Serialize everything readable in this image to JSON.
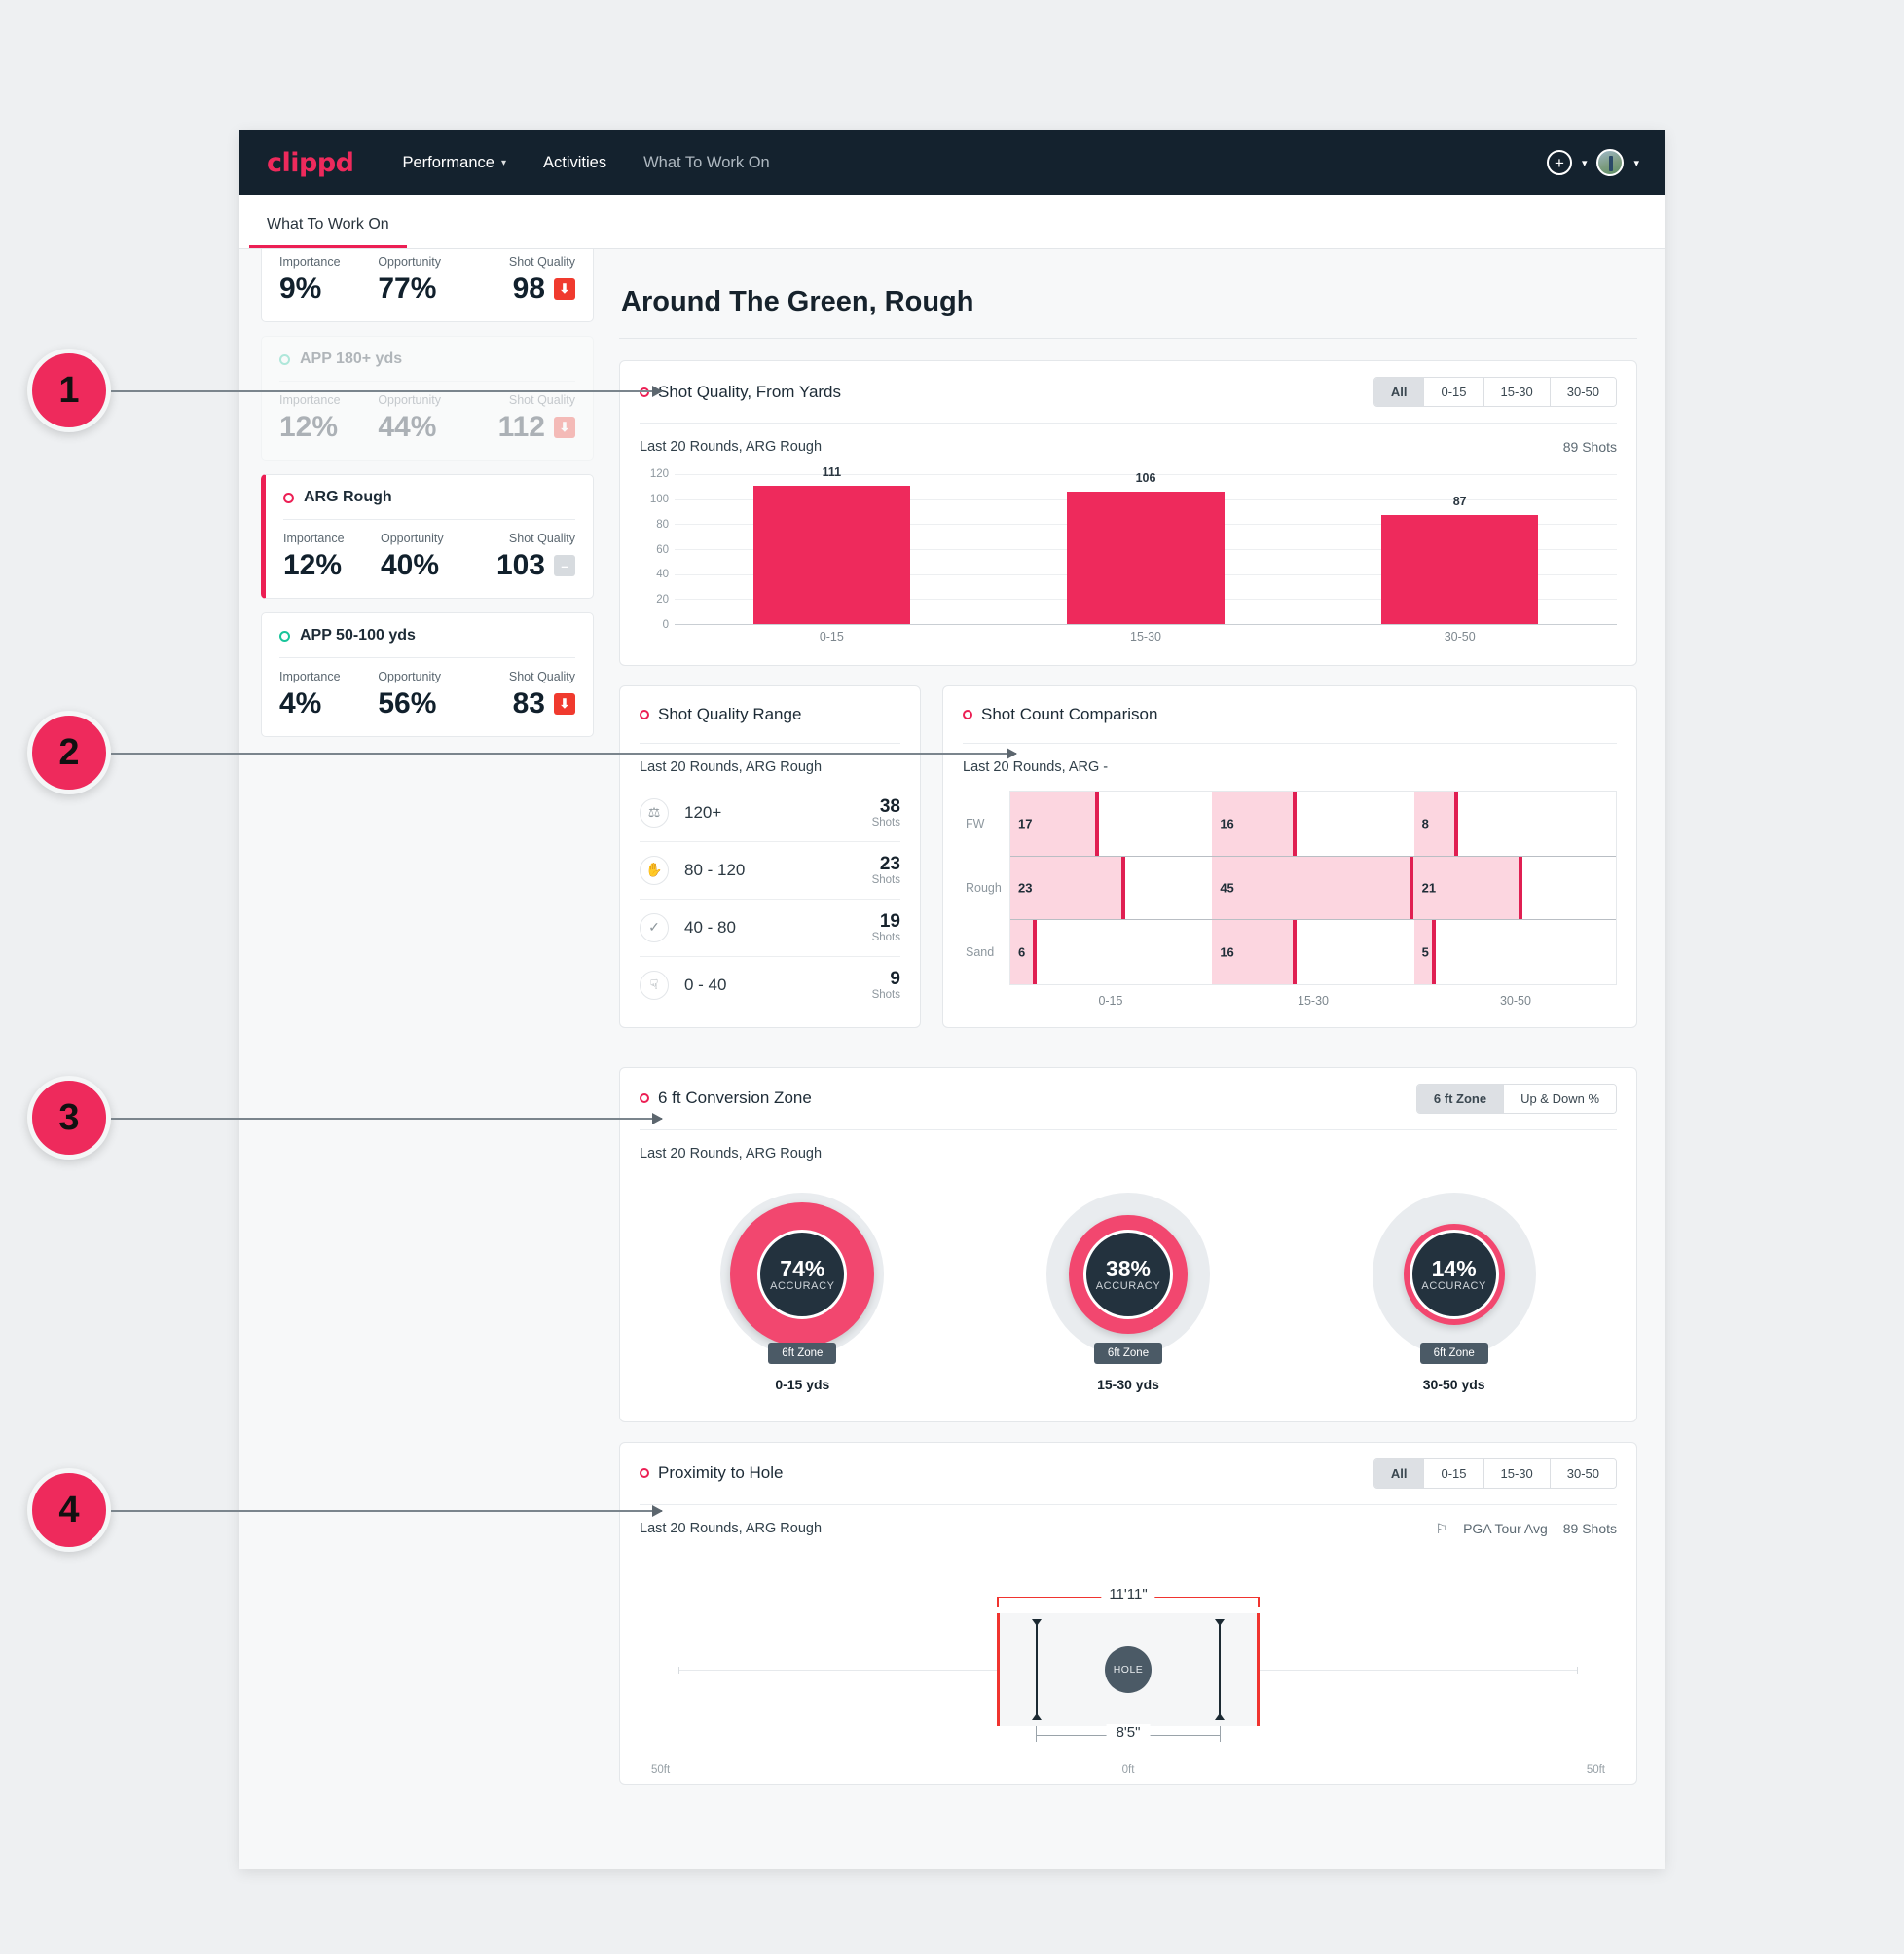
{
  "nav": {
    "brand": "clippd",
    "links": [
      {
        "label": "Performance",
        "caret": "chevron-down"
      },
      {
        "label": "Activities",
        "caret": ""
      },
      {
        "label": "What To Work On",
        "caret": ""
      }
    ],
    "add_icon": "plus-circle-icon",
    "avatar_icon": "avatar"
  },
  "tab": {
    "label": "What To Work On"
  },
  "sidebar": {
    "cards": [
      {
        "title": "",
        "importance_label": "Importance",
        "importance": "9%",
        "opportunity_label": "Opportunity",
        "opportunity": "77%",
        "quality_label": "Shot Quality",
        "quality": "98",
        "trend": "down"
      },
      {
        "title": "APP 180+ yds",
        "importance_label": "Importance",
        "importance": "12%",
        "opportunity_label": "Opportunity",
        "opportunity": "44%",
        "quality_label": "Shot Quality",
        "quality": "112",
        "trend": "down"
      },
      {
        "title": "ARG Rough",
        "importance_label": "Importance",
        "importance": "12%",
        "opportunity_label": "Opportunity",
        "opportunity": "40%",
        "quality_label": "Shot Quality",
        "quality": "103",
        "trend": "flat"
      },
      {
        "title": "APP 50-100 yds",
        "importance_label": "Importance",
        "importance": "4%",
        "opportunity_label": "Opportunity",
        "opportunity": "56%",
        "quality_label": "Shot Quality",
        "quality": "83",
        "trend": "down"
      }
    ]
  },
  "page": {
    "title": "Around The Green, Rough"
  },
  "shot_quality": {
    "title": "Shot Quality, From Yards",
    "segments": [
      "All",
      "0-15",
      "15-30",
      "30-50"
    ],
    "active_segment": "All",
    "subtitle": "Last 20 Rounds, ARG Rough",
    "shots": "89 Shots"
  },
  "quality_range": {
    "title": "Shot Quality Range",
    "subtitle": "Last 20 Rounds, ARG Rough",
    "items": [
      {
        "icon": "medal-icon",
        "glyph": "♑",
        "label": "120+",
        "count": "38",
        "unit": "Shots"
      },
      {
        "icon": "clap-icon",
        "glyph": "✋",
        "label": "80 - 120",
        "count": "23",
        "unit": "Shots"
      },
      {
        "icon": "check-icon",
        "glyph": "✓",
        "label": "40 - 80",
        "count": "19",
        "unit": "Shots"
      },
      {
        "icon": "thumbs-down-icon",
        "glyph": "☟",
        "label": "0 - 40",
        "count": "9",
        "unit": "Shots"
      }
    ]
  },
  "shot_count": {
    "title": "Shot Count Comparison",
    "subtitle": "Last 20 Rounds, ARG -"
  },
  "conversion": {
    "title": "6 ft Conversion Zone",
    "segments": [
      "6 ft Zone",
      "Up & Down %"
    ],
    "active_segment": "6 ft Zone",
    "subtitle": "Last 20 Rounds, ARG Rough",
    "donuts": [
      {
        "pct": "74%",
        "accuracy_label": "ACCURACY",
        "chip": "6ft Zone",
        "caption": "0-15 yds",
        "ring_size": 148
      },
      {
        "pct": "38%",
        "accuracy_label": "ACCURACY",
        "chip": "6ft Zone",
        "caption": "15-30 yds",
        "ring_size": 122
      },
      {
        "pct": "14%",
        "accuracy_label": "ACCURACY",
        "chip": "6ft Zone",
        "caption": "30-50 yds",
        "ring_size": 104
      }
    ]
  },
  "proximity": {
    "title": "Proximity to Hole",
    "segments": [
      "All",
      "0-15",
      "15-30",
      "30-50"
    ],
    "active_segment": "All",
    "subtitle": "Last 20 Rounds, ARG Rough",
    "tour_avg": "PGA Tour Avg",
    "shots": "89 Shots",
    "outer_dim": "11'11\"",
    "inner_dim": "8'5\"",
    "hole_label": "HOLE",
    "axis": {
      "left": "50ft",
      "center": "0ft",
      "right": "50ft"
    }
  },
  "callouts": [
    {
      "number": "1",
      "top": 355,
      "left": 28,
      "line": 430
    },
    {
      "number": "2",
      "top": 730,
      "left": 28,
      "line": 700
    },
    {
      "number": "3",
      "top": 1105,
      "left": 28,
      "line": 430
    },
    {
      "number": "4",
      "top": 1508,
      "left": 28,
      "line": 430
    }
  ],
  "colors": {
    "accent": "#ee2a5c",
    "nav_bg": "#14222e",
    "teal": "#19c49a",
    "fill_pink": "#fcd6e0",
    "marker": "#e01f52"
  },
  "chart_data": [
    {
      "type": "bar",
      "title": "Shot Quality, From Yards",
      "subtitle": "Last 20 Rounds, ARG Rough",
      "categories": [
        "0-15",
        "15-30",
        "30-50"
      ],
      "values": [
        111,
        106,
        87
      ],
      "xlabel": "",
      "ylabel": "",
      "ylim": [
        0,
        120
      ],
      "yticks": [
        0,
        20,
        40,
        60,
        80,
        100,
        120
      ],
      "grid": true,
      "legend": "none",
      "total_shots": 89,
      "bar_color": "#ee2a5c"
    },
    {
      "type": "table",
      "title": "Shot Quality Range",
      "subtitle": "Last 20 Rounds, ARG Rough",
      "columns": [
        "Range",
        "Shots"
      ],
      "rows": [
        [
          "120+",
          38
        ],
        [
          "80 - 120",
          23
        ],
        [
          "40 - 80",
          19
        ],
        [
          "0 - 40",
          9
        ]
      ]
    },
    {
      "type": "bar",
      "title": "Shot Count Comparison",
      "subtitle": "Last 20 Rounds, ARG -",
      "orientation": "horizontal-grouped",
      "categories": [
        "0-15",
        "15-30",
        "30-50"
      ],
      "series": [
        {
          "name": "FW",
          "values": [
            17,
            16,
            8
          ]
        },
        {
          "name": "Rough",
          "values": [
            23,
            45,
            21
          ]
        },
        {
          "name": "Sand",
          "values": [
            6,
            16,
            5
          ]
        }
      ],
      "grid": true,
      "legend": "none",
      "fill_color": "#fcd6e0",
      "marker_color": "#e01f52"
    },
    {
      "type": "pie",
      "title": "6 ft Conversion Zone",
      "subtitle": "Last 20 Rounds, ARG Rough",
      "variant": "donut-gauges",
      "categories": [
        "0-15 yds",
        "15-30 yds",
        "30-50 yds"
      ],
      "values": [
        74,
        38,
        14
      ],
      "value_unit": "%",
      "value_label": "ACCURACY",
      "ring_color": "#f2476f",
      "track_color": "#e9ecef"
    },
    {
      "type": "scatter",
      "title": "Proximity to Hole",
      "subtitle": "Last 20 Rounds, ARG Rough",
      "variant": "dispersion-box",
      "annotations": [
        "11'11\"",
        "8'5\"",
        "HOLE"
      ],
      "outer_spread_ft": 11.92,
      "inner_spread_ft": 8.42,
      "xticks": [
        "50ft",
        "0ft",
        "50ft"
      ],
      "xlim": [
        -50,
        50
      ],
      "reference": "PGA Tour Avg",
      "total_shots": 89
    }
  ]
}
